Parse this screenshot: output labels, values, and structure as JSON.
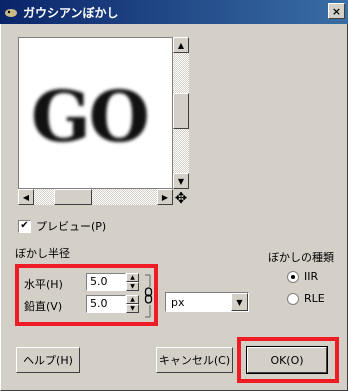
{
  "window": {
    "title": "ガウシアンぼかし",
    "close_label": "×"
  },
  "preview": {
    "sample_text": "GO",
    "checkbox_label": "プレビュー(P)",
    "checked": true
  },
  "blur_radius": {
    "heading": "ぼかし半径",
    "horizontal_label": "水平(H)",
    "horizontal_value": "5.0",
    "vertical_label": "鉛直(V)",
    "vertical_value": "5.0",
    "unit": "px"
  },
  "blur_method": {
    "heading": "ぼかしの種類",
    "options": [
      {
        "label": "IIR",
        "selected": true
      },
      {
        "label": "RLE",
        "selected": false
      }
    ]
  },
  "buttons": {
    "help": "ヘルプ(H)",
    "cancel": "キャンセル(C)",
    "ok": "OK(O)"
  },
  "highlight_color": "#ee1c24"
}
